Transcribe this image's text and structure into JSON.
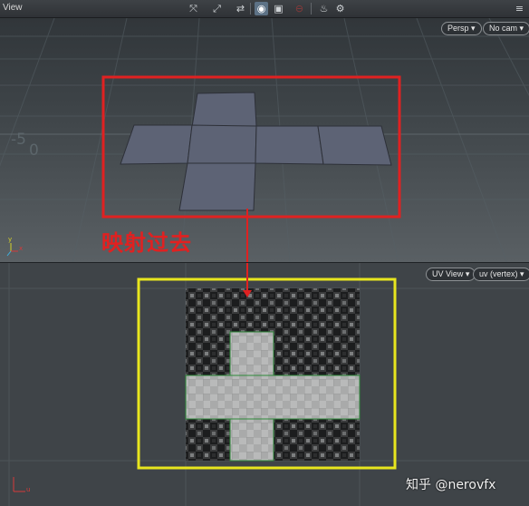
{
  "toolbar": {
    "title": "View",
    "icons": [
      "handle-icon",
      "snap-icon",
      "transform-icon",
      "camera-icon",
      "display-icon",
      "render-icon",
      "ghost-icon",
      "settings-icon"
    ]
  },
  "persp_view": {
    "camera_menu": "Persp ▾",
    "cam_menu": "No cam ▾",
    "grid_label_minus5": "-5",
    "grid_label_0": "0"
  },
  "annotation": {
    "text": "映射过去",
    "red_box_color": "#e02121",
    "yellow_box_color": "#e8e61e"
  },
  "uv_view": {
    "view_menu": "UV View ▾",
    "attr_menu": "uv (vertex) ▾"
  },
  "axis": {
    "x": "x",
    "y": "y",
    "u": "u"
  },
  "watermark": "知乎 @nerovfx"
}
